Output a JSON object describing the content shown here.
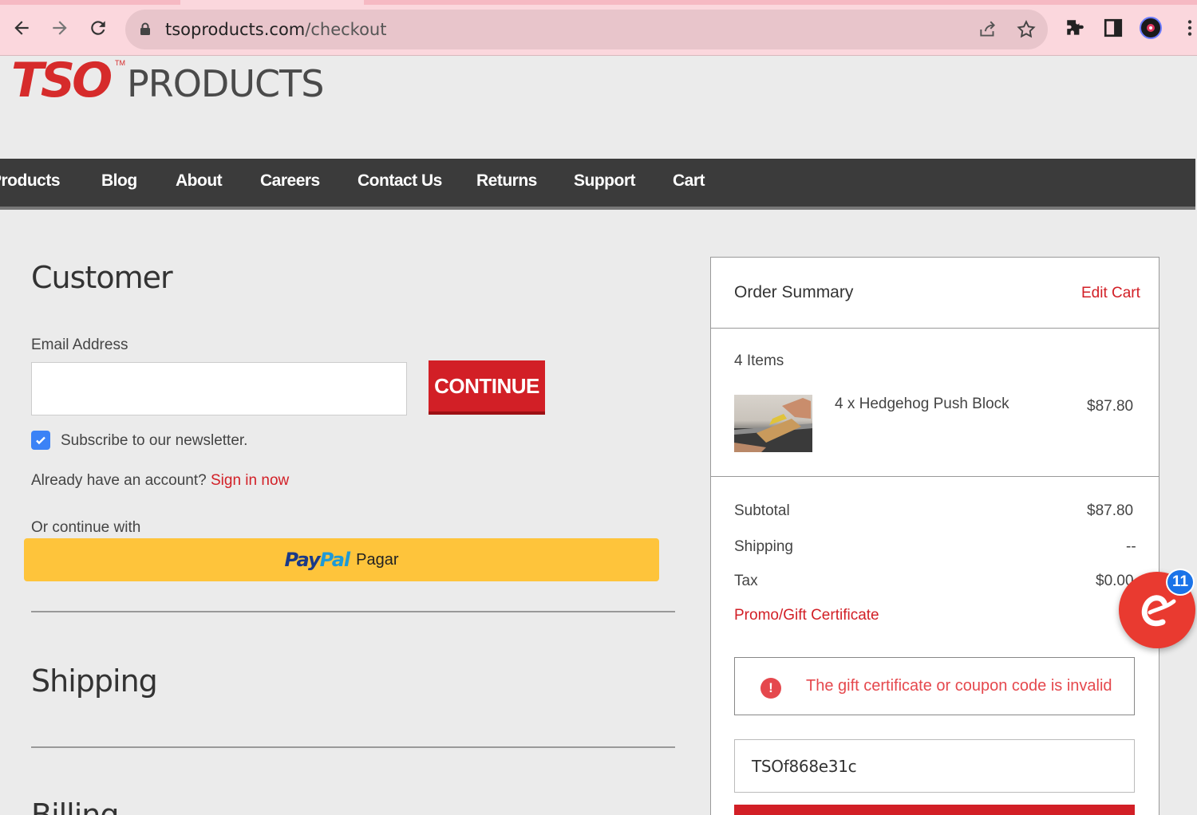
{
  "browser": {
    "url_host": "tsoproducts.com",
    "url_path": "/checkout",
    "icons": [
      "back-arrow-icon",
      "forward-arrow-icon",
      "reload-icon",
      "lock-icon",
      "share-icon",
      "bookmark-star-icon",
      "extensions-puzzle-icon",
      "side-panel-icon",
      "profile-avatar-icon",
      "kebab-menu-icon"
    ]
  },
  "header": {
    "logo_mark": "TSO",
    "logo_tm": "TM",
    "logo_word": "PRODUCTS"
  },
  "nav": {
    "items": [
      "Products",
      "Blog",
      "About",
      "Careers",
      "Contact Us",
      "Returns",
      "Support",
      "Cart"
    ]
  },
  "customer": {
    "title": "Customer",
    "email_label": "Email Address",
    "email_value": "",
    "continue_label": "CONTINUE",
    "newsletter_label": "Subscribe to our newsletter.",
    "newsletter_checked": true,
    "account_prompt": "Already have an account?",
    "sign_in_link": "Sign in now",
    "or_continue": "Or continue with",
    "paypal_a": "Pay",
    "paypal_b": "Pal",
    "paypal_pagar": "Pagar"
  },
  "shipping": {
    "title": "Shipping"
  },
  "billing": {
    "title": "Billing"
  },
  "summary": {
    "title": "Order Summary",
    "edit_cart": "Edit Cart",
    "items_count": "4 Items",
    "line_item_name": "4 x Hedgehog Push Block",
    "line_item_price": "$87.80",
    "subtotal_label": "Subtotal",
    "subtotal_value": "$87.80",
    "shipping_label": "Shipping",
    "shipping_value": "--",
    "tax_label": "Tax",
    "tax_value": "$0.00",
    "promo_link": "Promo/Gift Certificate",
    "error_message": "The gift certificate or coupon code is invalid",
    "coupon_value": "TSOf868e31c"
  },
  "chat": {
    "badge_count": "11"
  },
  "colors": {
    "accent_red": "#d21f26",
    "nav_bg": "#3b3b3b",
    "paypal_yellow": "#fec43b",
    "error_red": "#e5484d",
    "chrome_pink": "#fbd7dd"
  }
}
